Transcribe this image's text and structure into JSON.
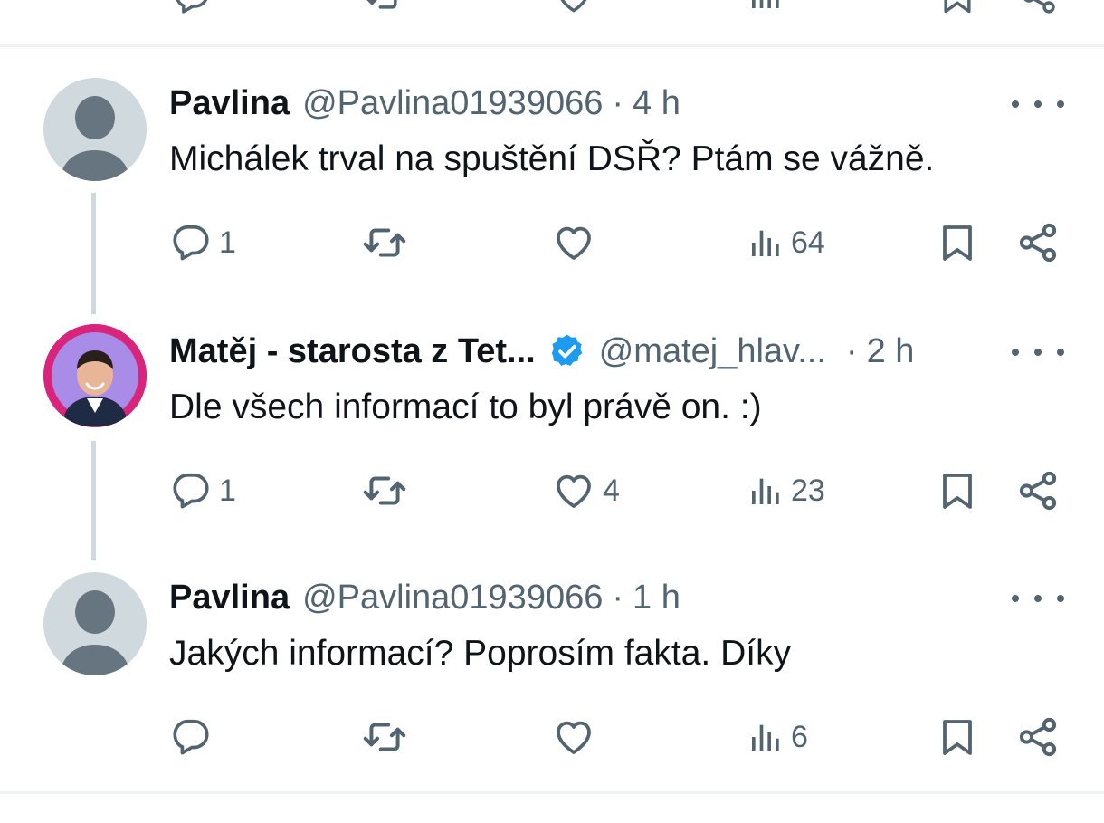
{
  "colors": {
    "text": "#0f1419",
    "muted": "#536471",
    "verified": "#1d9bf0",
    "avatar_ring": "#d8247a",
    "thread_line": "#cfd9de"
  },
  "tweets": [
    {
      "author": "Pavlina",
      "handle": "@Pavlina01939066",
      "dot": "·",
      "time": "4 h",
      "text": "Michálek trval na spuštění DSŘ? Ptám se vážně.",
      "reply_count": "1",
      "retweet_count": "",
      "like_count": "",
      "view_count": "64"
    },
    {
      "author": "Matěj - starosta z Tet...",
      "verified": true,
      "handle": "@matej_hlav...",
      "dot": "·",
      "time": "2 h",
      "text": "Dle všech informací to byl právě on. :)",
      "reply_count": "1",
      "retweet_count": "",
      "like_count": "4",
      "view_count": "23"
    },
    {
      "author": "Pavlina",
      "handle": "@Pavlina01939066",
      "dot": "·",
      "time": "1 h",
      "text": "Jakých informací? Poprosím fakta. Díky",
      "reply_count": "",
      "retweet_count": "",
      "like_count": "",
      "view_count": "6"
    }
  ],
  "icons": [
    "reply-icon",
    "retweet-icon",
    "like-icon",
    "views-icon",
    "bookmark-icon",
    "share-icon",
    "more-icon",
    "verified-badge-icon"
  ]
}
